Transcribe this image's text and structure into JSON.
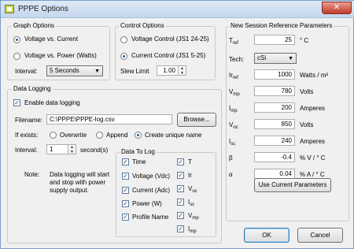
{
  "title": "PPPE Options",
  "close_glyph": "✕",
  "graph_options": {
    "title": "Graph Options",
    "opt1": "Voltage vs. Current",
    "opt2": "Voltage vs. Power (Watts)",
    "interval_label": "Interval:",
    "interval_value": "5 Seconds",
    "selected": "opt1"
  },
  "control_options": {
    "title": "Control Options",
    "opt1": "Voltage Control (JS1 24-25)",
    "opt2": "Current Control (JS1 5-25)",
    "slew_label": "Slew Limit",
    "slew_value": "1.00",
    "selected": "opt2"
  },
  "data_logging": {
    "title": "Data Logging",
    "enable_label": "Enable data logging",
    "enabled": true,
    "filename_label": "Filename:",
    "filename_value": "C:\\PPPE\\PPPE-log.csv",
    "browse_label": "Browse...",
    "if_exists_label": "If exists:",
    "overwrite_label": "Overwrite",
    "append_label": "Append",
    "create_unique_label": "Create unique name",
    "if_exists_selected": "create_unique",
    "interval_label": "Interval:",
    "interval_value": "1",
    "interval_unit": "second(s)",
    "note_label": "Note:",
    "note_text_1": "Data logging will start",
    "note_text_2": "and stop with power",
    "note_text_3": "supply output."
  },
  "data_to_log": {
    "title": "Data To Log",
    "left_items": [
      {
        "label": "Time",
        "checked": true
      },
      {
        "label": "Voltage (Vdc)",
        "checked": true
      },
      {
        "label": "Current (Adc)",
        "checked": true
      },
      {
        "label": "Power (W)",
        "checked": true
      },
      {
        "label": "Profile Name",
        "checked": true
      }
    ],
    "right_items": [
      {
        "label": "T",
        "checked": true
      },
      {
        "label": "Ir",
        "checked": true
      },
      {
        "label": "V",
        "sub": "oc",
        "checked": true
      },
      {
        "label": "I",
        "sub": "sc",
        "checked": true
      },
      {
        "label": "V",
        "sub": "mp",
        "checked": true
      },
      {
        "label": "I",
        "sub": "mp",
        "checked": true
      }
    ]
  },
  "session": {
    "title": "New Session Reference Parameters",
    "tref_label": "T",
    "tref_sub": "ref",
    "tref_value": "25",
    "tref_unit": "° C",
    "tech_label": "Tech:",
    "tech_value": "cSi",
    "irref_label": "Ir",
    "irref_sub": "ref",
    "irref_value": "1000",
    "irref_unit": "Watts / m²",
    "vmp_label": "V",
    "vmp_sub": "mp",
    "vmp_value": "780",
    "vmp_unit": "Volts",
    "imp_label": "I",
    "imp_sub": "mp",
    "imp_value": "200",
    "imp_unit": "Amperes",
    "voc_label": "V",
    "voc_sub": "oc",
    "voc_value": "850",
    "voc_unit": "Volts",
    "isc_label": "I",
    "isc_sub": "sc",
    "isc_value": "240",
    "isc_unit": "Amperes",
    "beta_label": "β",
    "beta_value": "-0.4",
    "beta_unit": "% V / ° C",
    "alpha_label": "α",
    "alpha_value": "0.04",
    "alpha_unit": "% A / ° C",
    "use_current_label": "Use Current Parameters"
  },
  "buttons": {
    "ok": "OK",
    "cancel": "Cancel"
  }
}
